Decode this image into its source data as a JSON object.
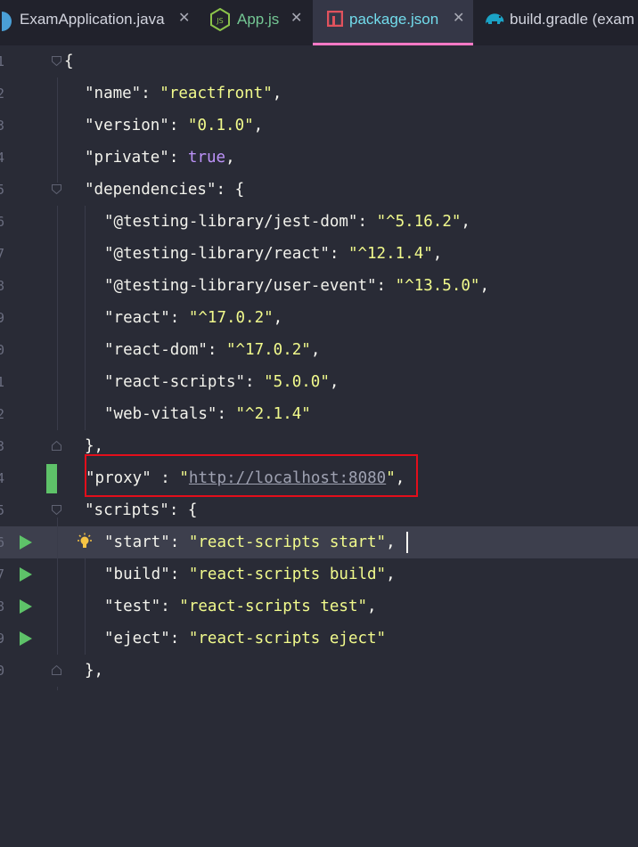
{
  "tabs": [
    {
      "label": "ExamApplication.java",
      "icon": "java-class-icon",
      "active": false
    },
    {
      "label": "App.js",
      "icon": "javascript-file-icon",
      "active": false
    },
    {
      "label": "package.json",
      "icon": "npm-package-icon",
      "active": true
    },
    {
      "label": "build.gradle (exam",
      "icon": "gradle-elephant-icon",
      "active": false
    }
  ],
  "close_glyph": "✕",
  "editor": {
    "file": "package.json",
    "lines": [
      {
        "num": "1",
        "text": "{"
      },
      {
        "num": "2",
        "key": "\"name\"",
        "sep": ": ",
        "value": "\"reactfront\"",
        "end": ","
      },
      {
        "num": "3",
        "key": "\"version\"",
        "sep": ": ",
        "value": "\"0.1.0\"",
        "end": ","
      },
      {
        "num": "4",
        "key": "\"private\"",
        "sep": ": ",
        "value": "true",
        "end": ","
      },
      {
        "num": "5",
        "key": "\"dependencies\"",
        "sep": ": ",
        "value": "{",
        "end": ""
      },
      {
        "num": "6",
        "key": "\"@testing-library/jest-dom\"",
        "sep": ": ",
        "value": "\"^5.16.2\"",
        "end": ","
      },
      {
        "num": "7",
        "key": "\"@testing-library/react\"",
        "sep": ": ",
        "value": "\"^12.1.4\"",
        "end": ","
      },
      {
        "num": "8",
        "key": "\"@testing-library/user-event\"",
        "sep": ": ",
        "value": "\"^13.5.0\"",
        "end": ","
      },
      {
        "num": "9",
        "key": "\"react\"",
        "sep": ": ",
        "value": "\"^17.0.2\"",
        "end": ","
      },
      {
        "num": "0",
        "key": "\"react-dom\"",
        "sep": ": ",
        "value": "\"^17.0.2\"",
        "end": ","
      },
      {
        "num": "1",
        "key": "\"react-scripts\"",
        "sep": ": ",
        "value": "\"5.0.0\"",
        "end": ","
      },
      {
        "num": "2",
        "key": "\"web-vitals\"",
        "sep": ": ",
        "value": "\"^2.1.4\"",
        "end": ""
      },
      {
        "num": "3",
        "text": "},"
      },
      {
        "num": "4",
        "key": "\"proxy\"",
        "sep": " : ",
        "q1": "\"",
        "url": "http://localhost:8080",
        "q2": "\"",
        "end": ","
      },
      {
        "num": "5",
        "key": "\"scripts\"",
        "sep": ": ",
        "value": "{",
        "end": ""
      },
      {
        "num": "6",
        "key": "\"start\"",
        "sep": ": ",
        "value": "\"react-scripts start\"",
        "end": ","
      },
      {
        "num": "7",
        "key": "\"build\"",
        "sep": ": ",
        "value": "\"react-scripts build\"",
        "end": ","
      },
      {
        "num": "8",
        "key": "\"test\"",
        "sep": ": ",
        "value": "\"react-scripts test\"",
        "end": ","
      },
      {
        "num": "9",
        "key": "\"eject\"",
        "sep": ": ",
        "value": "\"react-scripts eject\"",
        "end": ""
      },
      {
        "num": "0",
        "text": "},"
      }
    ]
  },
  "colors": {
    "background": "#292b36",
    "tab_bar": "#21222c",
    "active_tab": "#353747",
    "active_tab_text": "#72dcec",
    "active_tab_underline": "#ff79c6",
    "string": "#f1fa8c",
    "boolean": "#bd93f9",
    "highlight_box": "#e30e1b",
    "vcs_change_marker": "#5ec269",
    "run_gutter": "#5ec269"
  }
}
